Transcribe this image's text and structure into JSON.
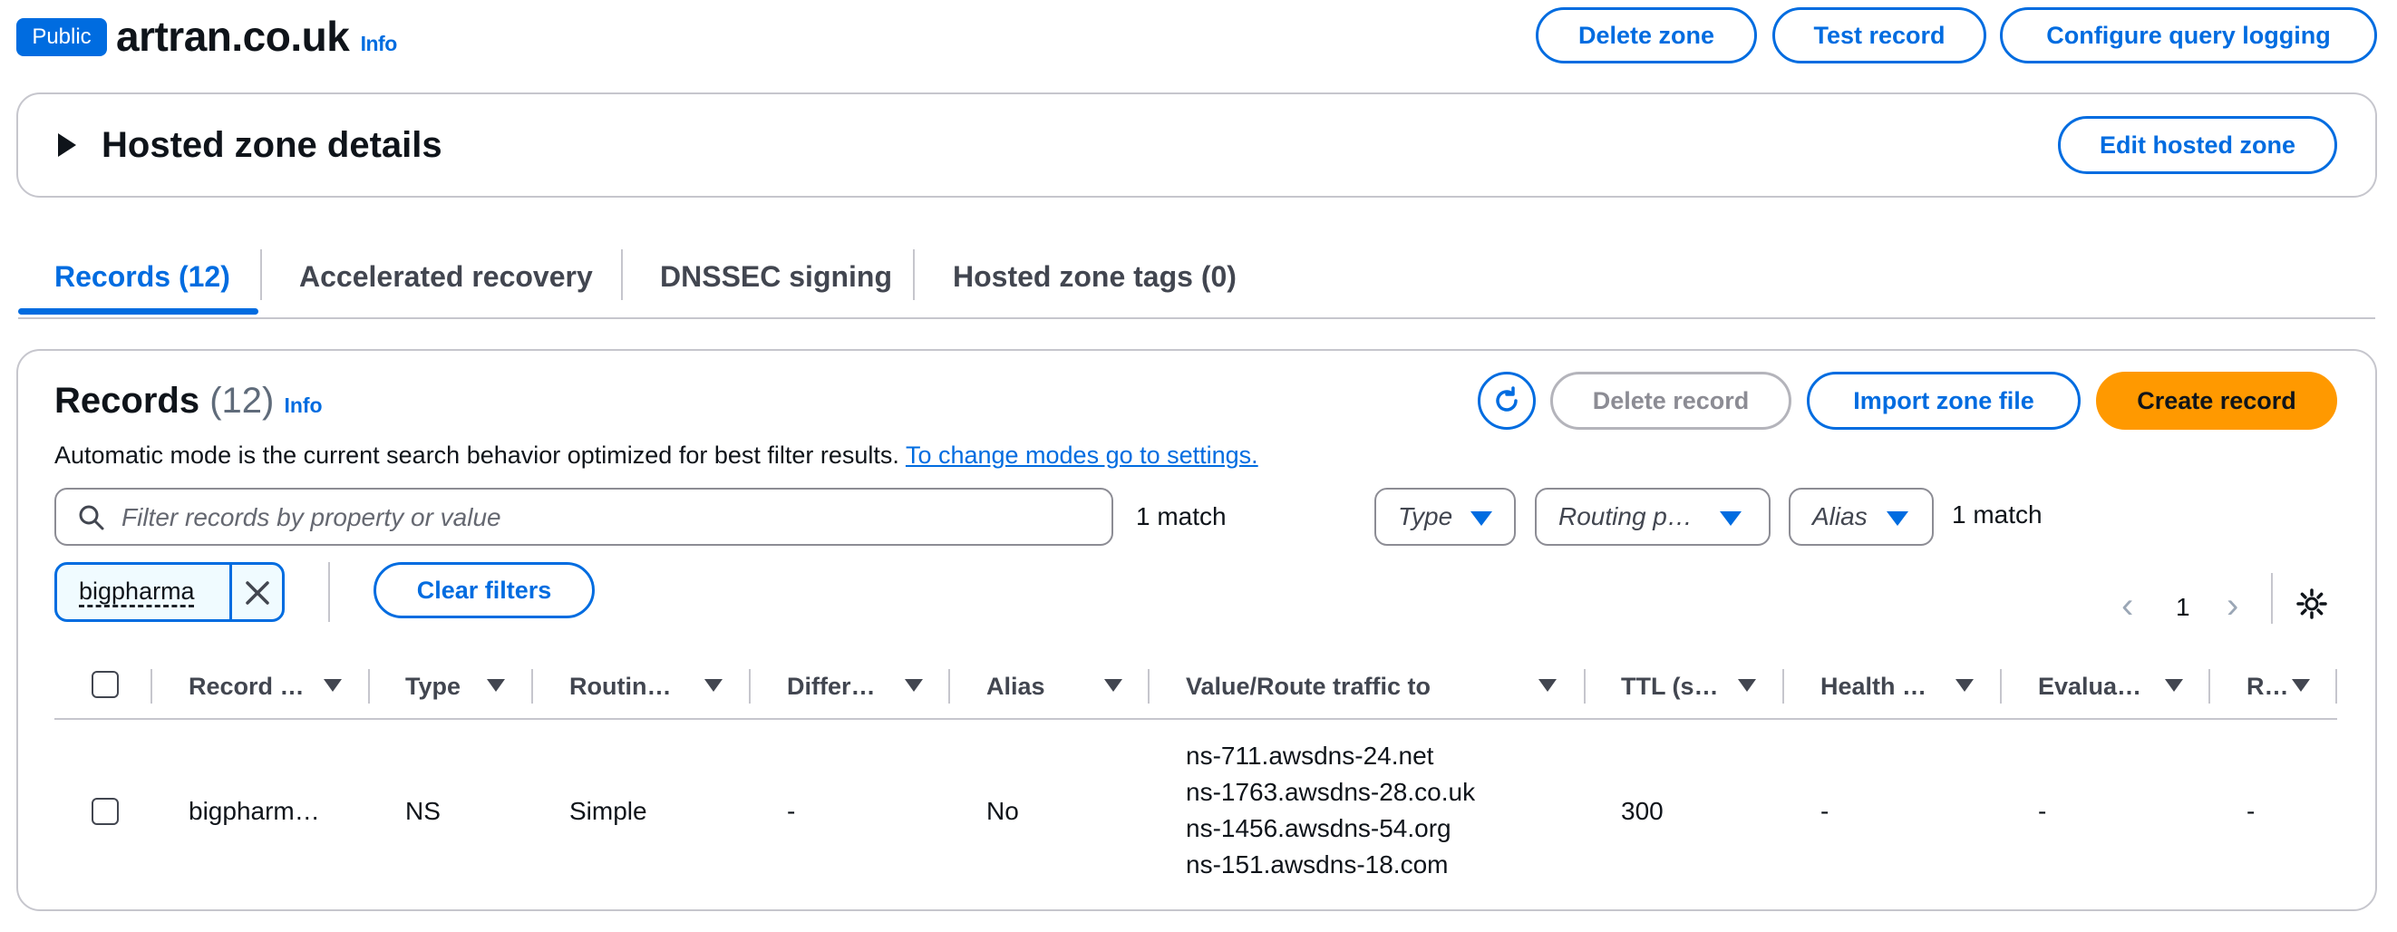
{
  "header": {
    "badge": "Public",
    "zone_name": "artran.co.uk",
    "info": "Info",
    "buttons": {
      "delete_zone": "Delete zone",
      "test_record": "Test record",
      "configure_logging": "Configure query logging"
    }
  },
  "details": {
    "title": "Hosted zone details",
    "edit_button": "Edit hosted zone"
  },
  "tabs": [
    {
      "label": "Records (12)",
      "active": true
    },
    {
      "label": "Accelerated recovery",
      "active": false
    },
    {
      "label": "DNSSEC signing",
      "active": false
    },
    {
      "label": "Hosted zone tags (0)",
      "active": false
    }
  ],
  "records": {
    "title": "Records",
    "count": "(12)",
    "info": "Info",
    "refresh_icon": "refresh-icon",
    "buttons": {
      "delete": "Delete record",
      "import": "Import zone file",
      "create": "Create record"
    },
    "description": "Automatic mode is the current search behavior optimized for best filter results.",
    "description_link": "To change modes go to settings.",
    "search": {
      "placeholder": "Filter records by property or value",
      "match": "1 match"
    },
    "filters": {
      "type": "Type",
      "routing": "Routing p…",
      "alias": "Alias",
      "match": "1 match"
    },
    "token": "bigpharma",
    "clear_filters": "Clear filters",
    "pagination": {
      "page": "1"
    },
    "columns": [
      "Record …",
      "Type",
      "Routin…",
      "Differ…",
      "Alias",
      "Value/Route traffic to",
      "TTL (s…",
      "Health …",
      "Evalua…",
      "R…"
    ],
    "rows": [
      {
        "name": "bigpharm…",
        "type": "NS",
        "routing": "Simple",
        "differentiator": "-",
        "alias": "No",
        "values": [
          "ns-711.awsdns-24.net",
          "ns-1763.awsdns-28.co.uk",
          "ns-1456.awsdns-54.org",
          "ns-151.awsdns-18.com"
        ],
        "ttl": "300",
        "health": "-",
        "evaluate": "-",
        "r": "-"
      }
    ]
  },
  "colors": {
    "accent": "#006ce0",
    "primary_button": "#ff9900",
    "border": "#c6c6cd"
  }
}
